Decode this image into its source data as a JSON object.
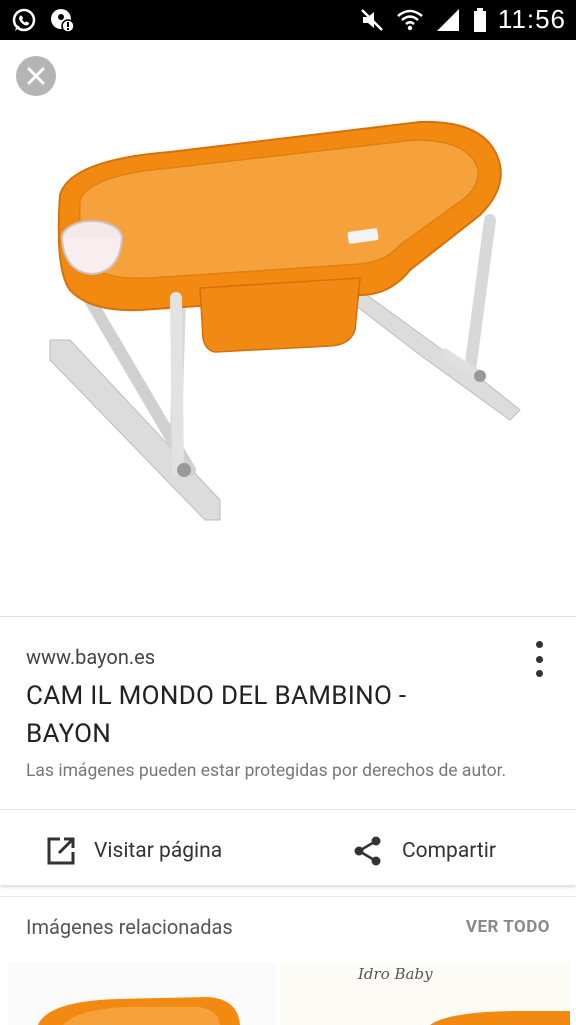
{
  "status_bar": {
    "time": "11:56",
    "left_icons": [
      "whatsapp-icon",
      "app-notification-icon"
    ],
    "right_icons": [
      "mute-icon",
      "wifi-icon",
      "signal-icon",
      "battery-icon"
    ]
  },
  "viewer": {
    "image_subject": "orange baby bath tub on folding stand"
  },
  "result": {
    "source": "www.bayon.es",
    "title": "CAM IL MONDO DEL BAMBINO - BAYON",
    "copyright_notice": "Las imágenes pueden estar protegidas por derechos de autor.",
    "visit_label": "Visitar página",
    "share_label": "Compartir"
  },
  "related": {
    "title": "Imágenes relacionadas",
    "see_all": "VER TODO",
    "thumb_caption": "Idro Baby"
  },
  "colors": {
    "tub_orange": "#f28a12",
    "status_bar": "#000000"
  }
}
